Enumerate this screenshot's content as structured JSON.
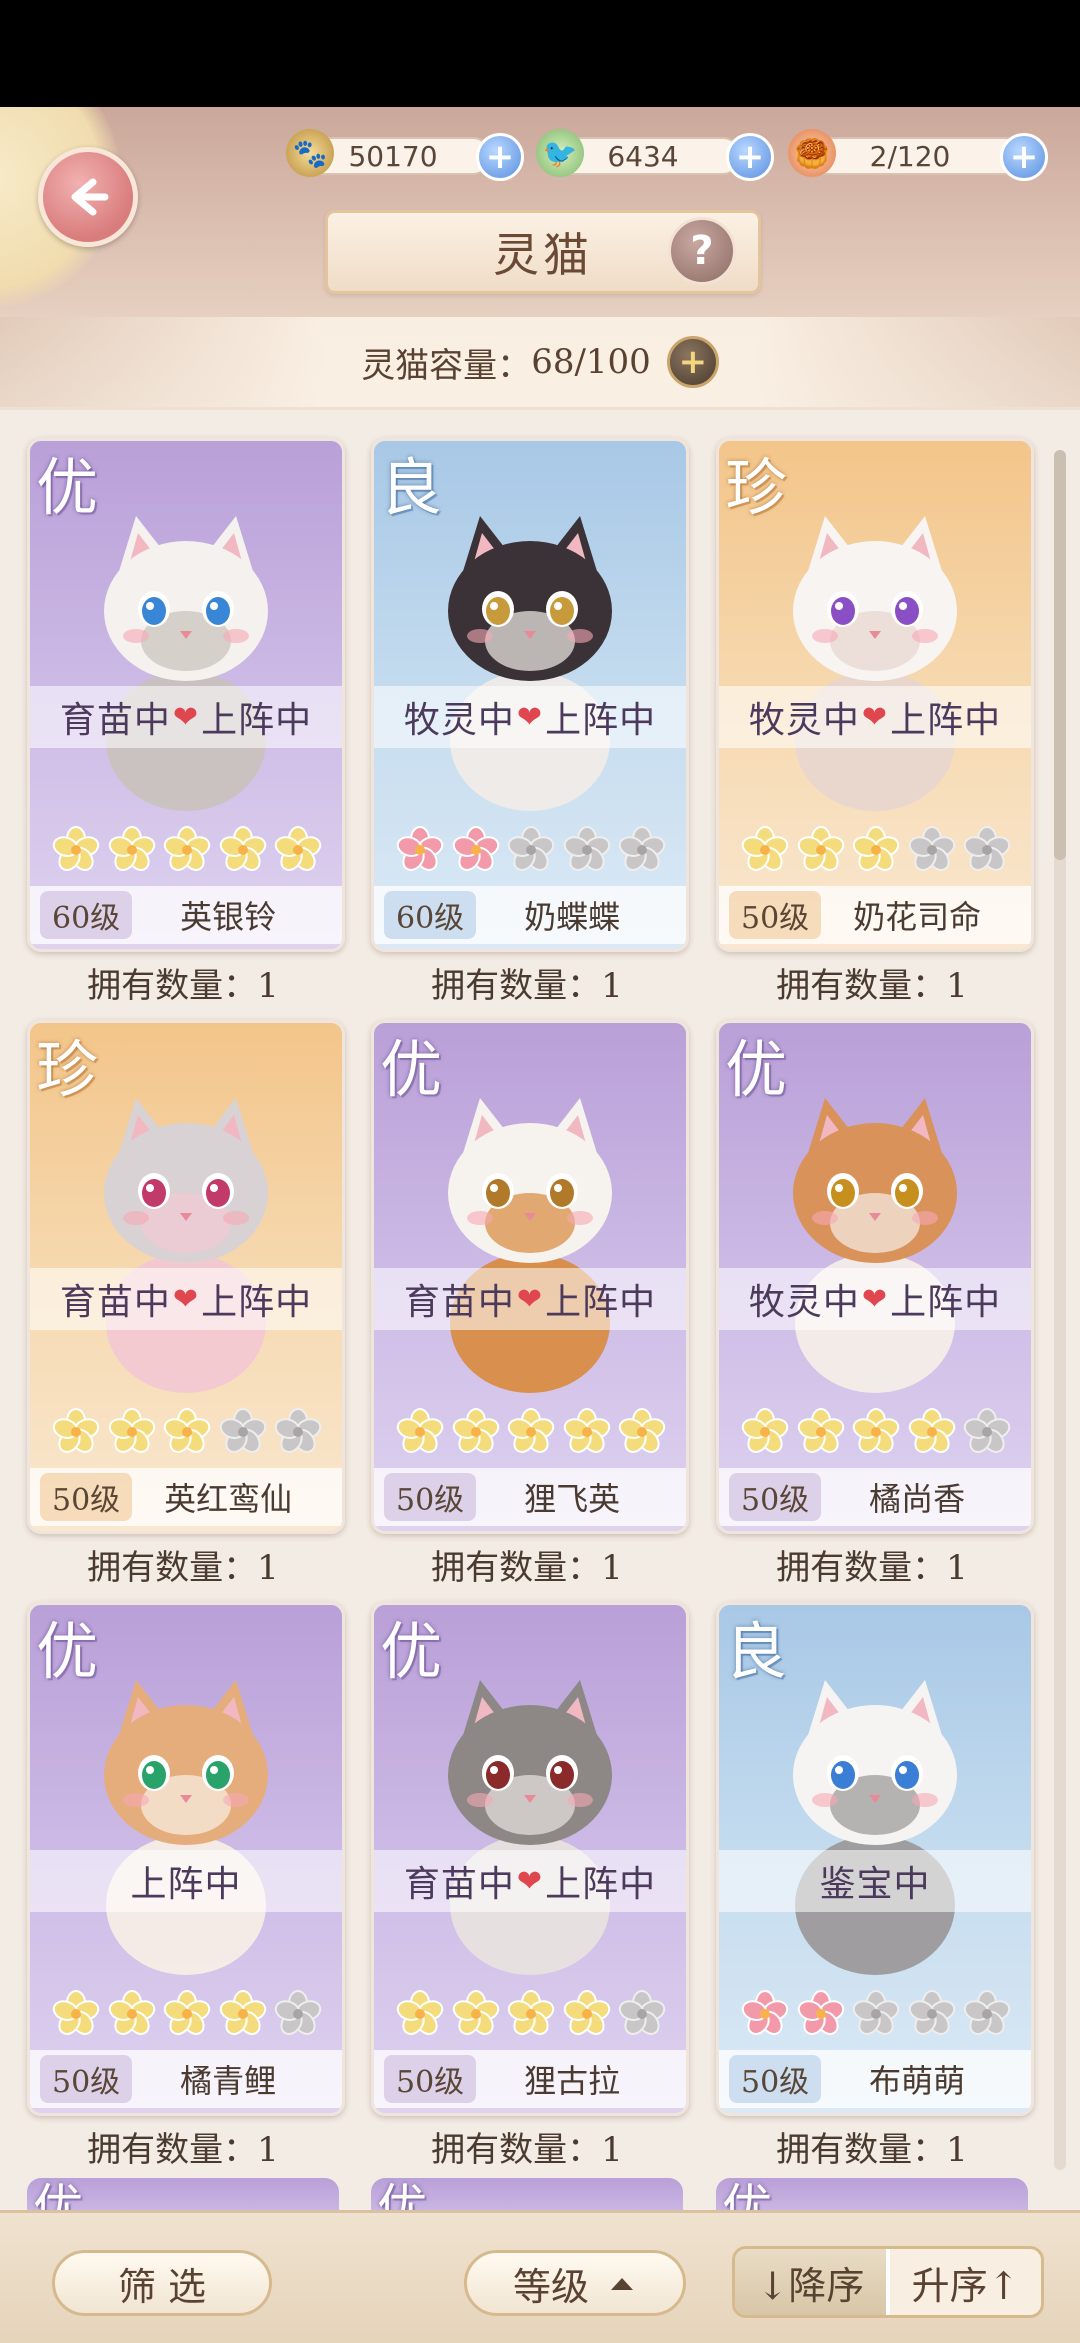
{
  "resources": [
    {
      "icon": "paw-coin-icon",
      "value": "50170"
    },
    {
      "icon": "leaf-bird-icon",
      "value": "6434"
    },
    {
      "icon": "food-bowl-icon",
      "value": "2/120"
    }
  ],
  "header": {
    "title": "灵猫",
    "help": "?",
    "capacity_label": "灵猫容量：",
    "capacity_value": "68/100"
  },
  "cats": [
    {
      "rarity": "优",
      "tier": "you",
      "status_a": "育苗中",
      "status_b": "上阵中",
      "level": "60级",
      "name": "英银铃",
      "own": "拥有数量：1",
      "stars_filled": 5,
      "star_color": "#f4dc7c",
      "fur": "#f4f1ee",
      "fur2": "#c9c2bc",
      "eye": "#3a86d6"
    },
    {
      "rarity": "良",
      "tier": "liang",
      "status_a": "牧灵中",
      "status_b": "上阵中",
      "level": "60级",
      "name": "奶蝶蝶",
      "own": "拥有数量：1",
      "stars_filled": 2,
      "star_color": "#f39aaa",
      "fur": "#3a3236",
      "fur2": "#f2ece8",
      "eye": "#c79a3c"
    },
    {
      "rarity": "珍",
      "tier": "zhen",
      "status_a": "牧灵中",
      "status_b": "上阵中",
      "level": "50级",
      "name": "奶花司命",
      "own": "拥有数量：1",
      "stars_filled": 3,
      "star_color": "#f4dc7c",
      "fur": "#f8f4f2",
      "fur2": "#e7d6cf",
      "eye": "#8a4fc4"
    },
    {
      "rarity": "珍",
      "tier": "zhen",
      "status_a": "育苗中",
      "status_b": "上阵中",
      "level": "50级",
      "name": "英红鸾仙",
      "own": "拥有数量：1",
      "stars_filled": 3,
      "star_color": "#f4dc7c",
      "fur": "#d8d2d4",
      "fur2": "#f3c8d4",
      "eye": "#c23a6a"
    },
    {
      "rarity": "优",
      "tier": "you",
      "status_a": "育苗中",
      "status_b": "上阵中",
      "level": "50级",
      "name": "狸飞英",
      "own": "拥有数量：1",
      "stars_filled": 5,
      "star_color": "#f4dc7c",
      "fur": "#f6f2ee",
      "fur2": "#d98a3c",
      "eye": "#b07a2a"
    },
    {
      "rarity": "优",
      "tier": "you",
      "status_a": "牧灵中",
      "status_b": "上阵中",
      "level": "50级",
      "name": "橘尚香",
      "own": "拥有数量：1",
      "stars_filled": 4,
      "star_color": "#f4dc7c",
      "fur": "#d9925a",
      "fur2": "#f5efe8",
      "eye": "#c7901e"
    },
    {
      "rarity": "优",
      "tier": "you",
      "status_a": "",
      "status_b": "上阵中",
      "level": "50级",
      "name": "橘青鲤",
      "own": "拥有数量：1",
      "stars_filled": 4,
      "star_color": "#f4dc7c",
      "fur": "#e6ad7c",
      "fur2": "#f8efe6",
      "eye": "#2aa36a"
    },
    {
      "rarity": "优",
      "tier": "you",
      "status_a": "育苗中",
      "status_b": "上阵中",
      "level": "50级",
      "name": "狸古拉",
      "own": "拥有数量：1",
      "stars_filled": 4,
      "star_color": "#f4dc7c",
      "fur": "#8d8886",
      "fur2": "#e8e3df",
      "eye": "#8a2a2a"
    },
    {
      "rarity": "良",
      "tier": "liang",
      "status_a": "",
      "status_b": "鉴宝中",
      "level": "50级",
      "name": "布萌萌",
      "own": "拥有数量：1",
      "stars_filled": 2,
      "star_color": "#f39aaa",
      "fur": "#f6f4f3",
      "fur2": "#9a9696",
      "eye": "#3a7ed6"
    }
  ],
  "peek_rarities": [
    "优",
    "优",
    "优"
  ],
  "bottom": {
    "filter": "筛 选",
    "sort_field": "等级",
    "desc": "↓降序",
    "asc": "升序↑"
  }
}
